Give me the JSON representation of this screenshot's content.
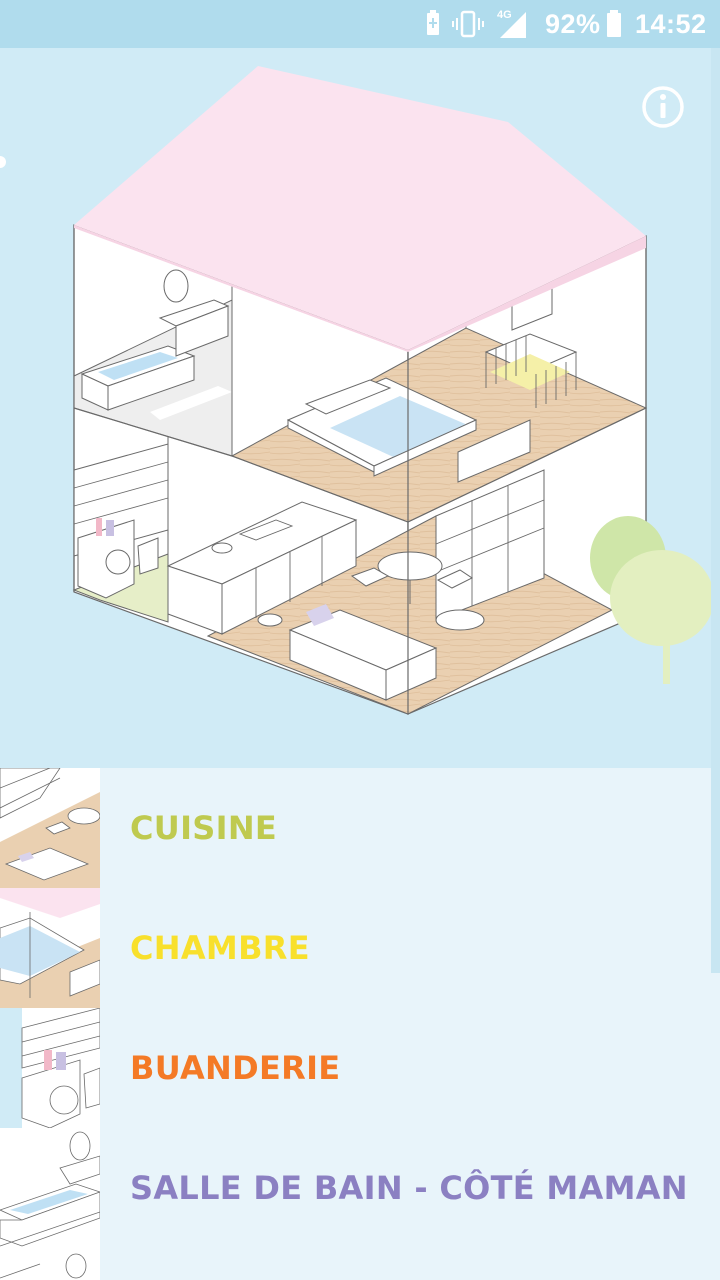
{
  "status_bar": {
    "battery_percent": "92%",
    "time": "14:52",
    "network_label": "4G",
    "icons": [
      "battery-charging-icon",
      "vibrate-icon",
      "signal-icon",
      "battery-icon"
    ]
  },
  "hero": {
    "illustration": "isometric-house-cutaway",
    "info_icon": "info-icon"
  },
  "rooms": [
    {
      "label": "CUISINE",
      "color": "#bfca4f",
      "thumb": "kitchen"
    },
    {
      "label": "CHAMBRE",
      "color": "#f8e02c",
      "thumb": "bedroom"
    },
    {
      "label": "BUANDERIE",
      "color": "#f47a26",
      "thumb": "laundry"
    },
    {
      "label": "SALLE DE BAIN - CÔTÉ MAMAN",
      "color": "#8b80c2",
      "thumb": "bathroom"
    }
  ],
  "colors": {
    "status_bar": "#b0dced",
    "hero_bg": "#d0ebf6",
    "list_bg": "#e8f4fa",
    "roof": "#fbe3ef",
    "wood": "#e9cfb0",
    "tree": "#dfeeb0"
  }
}
